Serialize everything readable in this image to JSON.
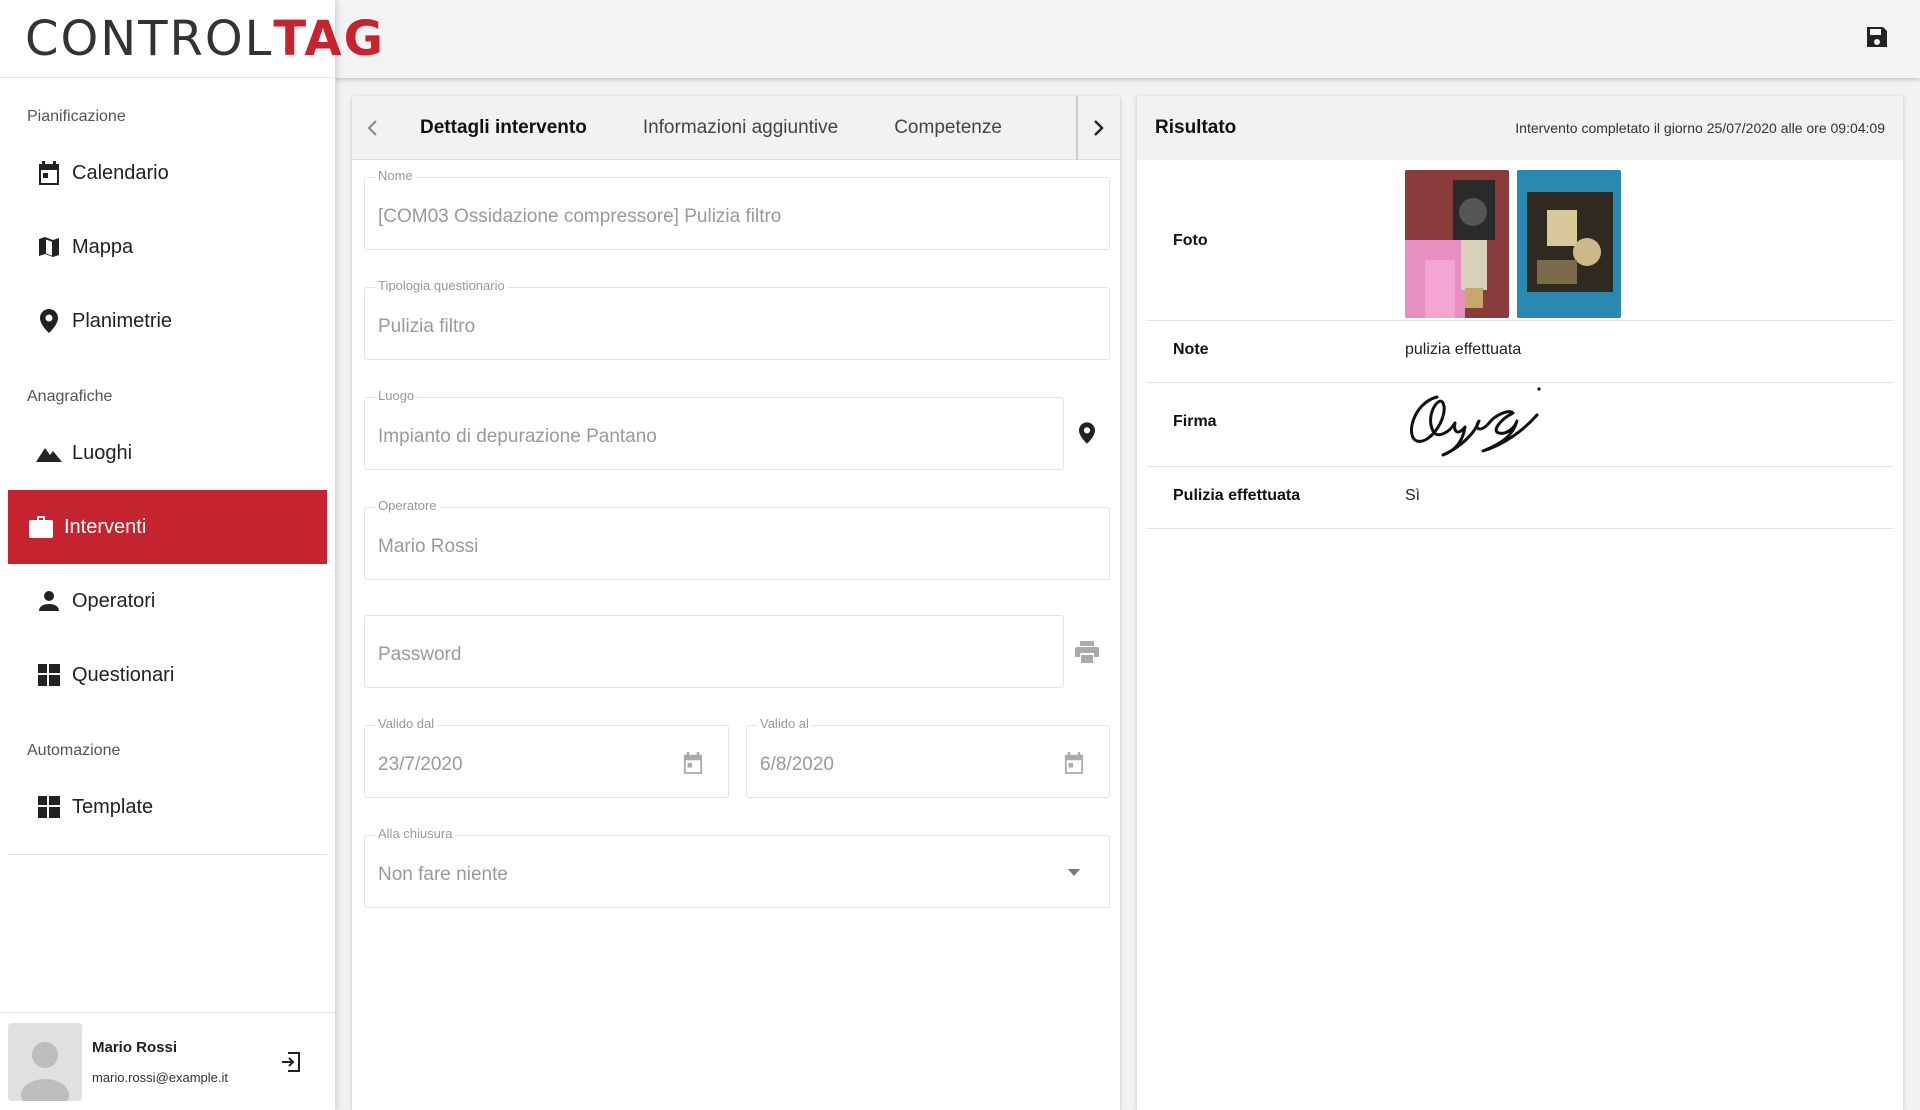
{
  "brand": {
    "part1": "CONTROL",
    "part2": "TAG"
  },
  "sidebar": {
    "sections": [
      {
        "label": "Pianificazione"
      },
      {
        "label": "Anagrafiche"
      },
      {
        "label": "Automazione"
      }
    ],
    "items": [
      {
        "label": "Calendario",
        "icon": "calendar-icon"
      },
      {
        "label": "Mappa",
        "icon": "map-icon"
      },
      {
        "label": "Planimetrie",
        "icon": "location-pin-icon"
      },
      {
        "label": "Luoghi",
        "icon": "landscape-icon"
      },
      {
        "label": "Interventi",
        "icon": "briefcase-icon",
        "active": true
      },
      {
        "label": "Operatori",
        "icon": "person-icon"
      },
      {
        "label": "Questionari",
        "icon": "dashboard-icon"
      },
      {
        "label": "Template",
        "icon": "dashboard-icon"
      }
    ]
  },
  "user": {
    "name": "Mario Rossi",
    "email": "mario.rossi@example.it"
  },
  "tabs": [
    {
      "label": "Dettagli intervento",
      "active": true
    },
    {
      "label": "Informazioni aggiuntive"
    },
    {
      "label": "Competenze"
    }
  ],
  "form": {
    "nome": {
      "label": "Nome",
      "value": "[COM03 Ossidazione compressore] Pulizia filtro"
    },
    "tipologia": {
      "label": "Tipologia questionario",
      "value": "Pulizia filtro"
    },
    "luogo": {
      "label": "Luogo",
      "value": "Impianto di depurazione Pantano"
    },
    "operatore": {
      "label": "Operatore",
      "value": "Mario Rossi"
    },
    "password": {
      "placeholder": "Password"
    },
    "valido_dal": {
      "label": "Valido dal",
      "value": "23/7/2020"
    },
    "valido_al": {
      "label": "Valido al",
      "value": "6/8/2020"
    },
    "alla_chiusura": {
      "label": "Alla chiusura",
      "value": "Non fare niente"
    }
  },
  "result": {
    "title": "Risultato",
    "status": "Intervento completato il giorno 25/07/2020 alle ore 09:04:09",
    "rows": [
      {
        "label": "Foto"
      },
      {
        "label": "Note",
        "value": "pulizia effettuata"
      },
      {
        "label": "Firma"
      },
      {
        "label": "Pulizia effettuata",
        "value": "Sì"
      }
    ]
  },
  "colors": {
    "accent": "#c5232e",
    "muted_text": "#9a9a9a"
  }
}
